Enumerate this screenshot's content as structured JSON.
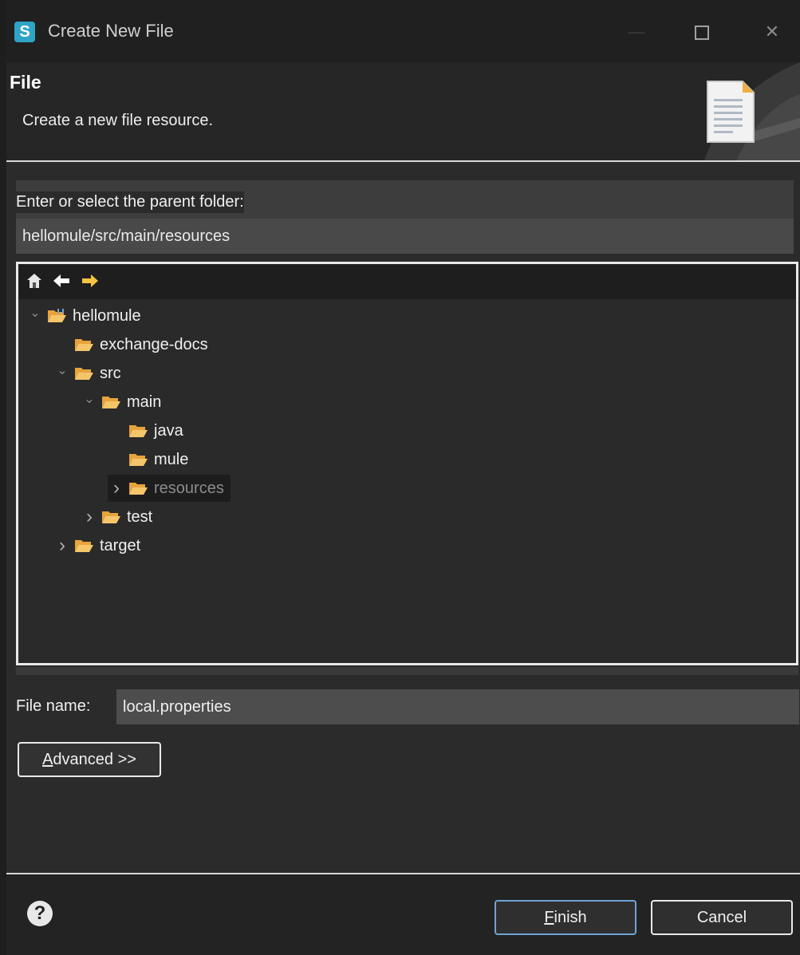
{
  "window": {
    "title": "Create New File",
    "app_icon": "sts-app-icon"
  },
  "banner": {
    "title": "File",
    "description": "Create a new file resource."
  },
  "parent_folder": {
    "label": "Enter or select the parent folder:",
    "value": "hellomule/src/main/resources"
  },
  "tree": {
    "items": [
      {
        "label": "hellomule",
        "depth": 0,
        "expanded": true,
        "type": "project"
      },
      {
        "label": "exchange-docs",
        "depth": 1,
        "expanded": null,
        "type": "folder"
      },
      {
        "label": "src",
        "depth": 1,
        "expanded": true,
        "type": "folder"
      },
      {
        "label": "main",
        "depth": 2,
        "expanded": true,
        "type": "folder"
      },
      {
        "label": "java",
        "depth": 3,
        "expanded": null,
        "type": "folder"
      },
      {
        "label": "mule",
        "depth": 3,
        "expanded": null,
        "type": "folder"
      },
      {
        "label": "resources",
        "depth": 3,
        "expanded": false,
        "type": "folder",
        "selected": true
      },
      {
        "label": "test",
        "depth": 2,
        "expanded": false,
        "type": "folder"
      },
      {
        "label": "target",
        "depth": 1,
        "expanded": false,
        "type": "folder"
      }
    ]
  },
  "file_name": {
    "label": "File name:",
    "value": "local.properties"
  },
  "advanced_button": {
    "mnemonic": "A",
    "rest": "dvanced >>"
  },
  "footer": {
    "finish": {
      "mnemonic": "F",
      "rest": "inish"
    },
    "cancel": "Cancel"
  },
  "colors": {
    "folder": "#e8a33d",
    "accent": "#6fa3d6",
    "arrow": "#f5c242"
  }
}
